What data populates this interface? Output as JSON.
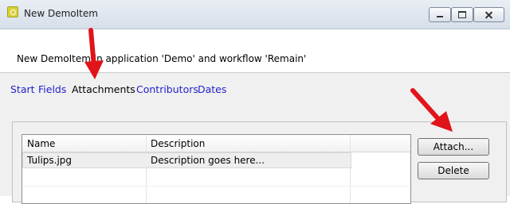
{
  "window": {
    "title": "New DemoItem"
  },
  "header": {
    "description": "New DemoItem in application 'Demo' and workflow 'Remain'"
  },
  "tabs": [
    {
      "label": "Start",
      "active": false
    },
    {
      "label": "Fields",
      "active": false
    },
    {
      "label": "Attachments",
      "active": true
    },
    {
      "label": "Contributors",
      "active": false
    },
    {
      "label": "Dates",
      "active": false
    }
  ],
  "attachments": {
    "columns": [
      "Name",
      "Description"
    ],
    "rows": [
      {
        "name": "Tulips.jpg",
        "description": "Description goes here..."
      }
    ],
    "attach_label": "Attach...",
    "delete_label": "Delete"
  },
  "colors": {
    "link": "#2222cc",
    "annotation_arrow": "#e0141a"
  }
}
